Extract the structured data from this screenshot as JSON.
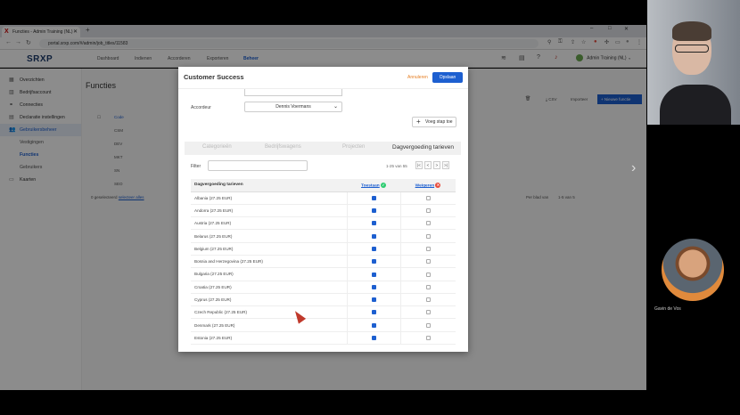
{
  "browser": {
    "tab_title": "Functies - Admin Training (NL)",
    "url": "portal.srxp.com/#/admin/job_titles/11583",
    "new_tab": "+",
    "win_min": "–",
    "win_max": "□",
    "win_close": "✕"
  },
  "app": {
    "logo": "SRXP",
    "nav": [
      "Dashboard",
      "Indienen",
      "Accorderen",
      "Exporteren",
      "Beheer"
    ],
    "user": "Admin Training (NL)"
  },
  "sidebar": {
    "items": [
      {
        "label": "Overzichten"
      },
      {
        "label": "Bedrijfsaccount"
      },
      {
        "label": "Connecties"
      },
      {
        "label": "Declaratie instellingen"
      },
      {
        "label": "Gebruikersbeheer"
      }
    ],
    "sub_items": [
      {
        "label": "Vestigingen"
      },
      {
        "label": "Functies"
      },
      {
        "label": "Gebruikers"
      }
    ],
    "last_item": {
      "label": "Kaarten"
    }
  },
  "main": {
    "title": "Functies",
    "col_code": "Code",
    "codes": [
      "CSM",
      "DEV",
      "MKT",
      "SN",
      "SEO"
    ],
    "selected_info": "0 geselecteerd",
    "select_all": "selecteer alles",
    "csv": "CSV",
    "import": "Importeer",
    "new_function": "Nieuwe functie",
    "per_page": "Per blad van",
    "range": "1-5 van 5"
  },
  "modal": {
    "title": "Customer Success",
    "cancel": "Annuleren",
    "save": "Opslaan",
    "top_field": "",
    "accordeur_label": "Accordeur",
    "accordeur_value": "Dennis Voermans",
    "add_step": "Voeg stap toe",
    "tabs": [
      "Categorieën",
      "Bedrijfswagens",
      "Projecten",
      "Dagvergoeding tarieven"
    ],
    "filter_label": "Filter",
    "pager_text": "1-25 van 55",
    "pager_first": "|<",
    "pager_prev": "<",
    "pager_next": ">",
    "pager_last": ">|",
    "col_name": "Dagvergoeding tarieven",
    "col_allow": "Toestaan",
    "col_deny": "Weigeren",
    "rows": [
      {
        "name": "Albania (27.25 EUR)",
        "allow": true,
        "deny": false
      },
      {
        "name": "Andorra (27.25 EUR)",
        "allow": true,
        "deny": false
      },
      {
        "name": "Austria (27.25 EUR)",
        "allow": true,
        "deny": false
      },
      {
        "name": "Belarus (27.25 EUR)",
        "allow": true,
        "deny": false
      },
      {
        "name": "Belgium (27.25 EUR)",
        "allow": true,
        "deny": false
      },
      {
        "name": "Bosnia and Herzegovina (27.25 EUR)",
        "allow": true,
        "deny": false
      },
      {
        "name": "Bulgaria (27.25 EUR)",
        "allow": true,
        "deny": false
      },
      {
        "name": "Croatia (27.25 EUR)",
        "allow": true,
        "deny": false
      },
      {
        "name": "Cyprus (27.25 EUR)",
        "allow": true,
        "deny": false
      },
      {
        "name": "Czech Republic (27.25 EUR)",
        "allow": true,
        "deny": false
      },
      {
        "name": "Denmark (27.25 EUR)",
        "allow": true,
        "deny": false
      },
      {
        "name": "Estonia (27.25 EUR)",
        "allow": true,
        "deny": false
      }
    ]
  },
  "video": {
    "participant_name": "Gavin de Vos"
  },
  "colors": {
    "accent": "#1d5fd0",
    "cancel": "#e67e22",
    "allow_icon": "#2ecc71",
    "deny_icon": "#e74c3c"
  }
}
